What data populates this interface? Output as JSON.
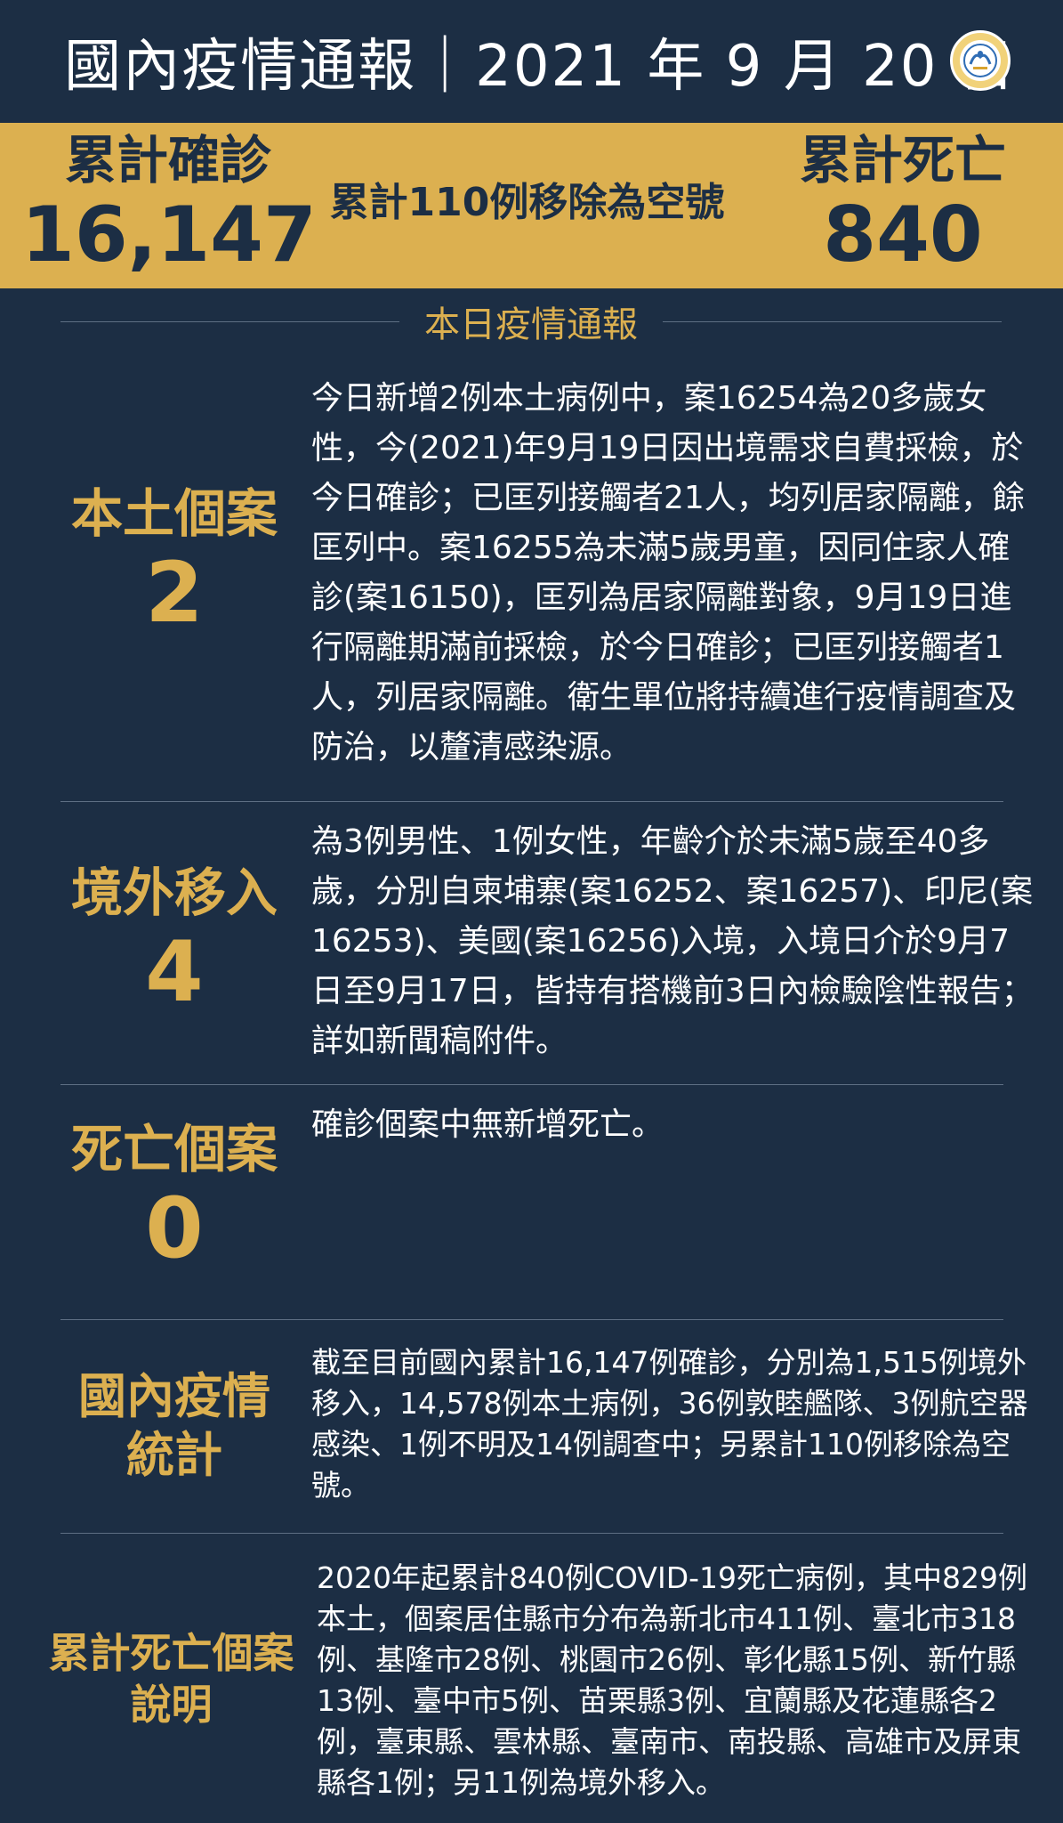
{
  "header": {
    "title": "國內疫情通報｜2021 年 9 月 20 日",
    "logo_icon": "cdc-logo-icon"
  },
  "summary": {
    "cumulative_cases_label": "累計確診",
    "cumulative_cases_value": "16,147",
    "note": "累計110例移除為空號",
    "cumulative_deaths_label": "累計死亡",
    "cumulative_deaths_value": "840"
  },
  "section_title": "本日疫情通報",
  "sections": [
    {
      "label": "本土個案",
      "value": "2",
      "description": "今日新增2例本土病例中，案16254為20多歲女性，今(2021)年9月19日因出境需求自費採檢，於今日確診；已匡列接觸者21人，均列居家隔離，餘匡列中。案16255為未滿5歲男童，因同住家人確診(案16150)，匡列為居家隔離對象，9月19日進行隔離期滿前採檢，於今日確診；已匡列接觸者1人，列居家隔離。衛生單位將持續進行疫情調查及防治，以釐清感染源。"
    },
    {
      "label": "境外移入",
      "value": "4",
      "description": "為3例男性、1例女性，年齡介於未滿5歲至40多歲，分別自柬埔寨(案16252、案16257)、印尼(案16253)、美國(案16256)入境，入境日介於9月7日至9月17日，皆持有搭機前3日內檢驗陰性報告；詳如新聞稿附件。"
    },
    {
      "label": "死亡個案",
      "value": "0",
      "description": "確診個案中無新增死亡。"
    },
    {
      "label_line1": "國內疫情",
      "label_line2": "統計",
      "description": "截至目前國內累計16,147例確診，分別為1,515例境外移入，14,578例本土病例，36例敦睦艦隊、3例航空器感染、1例不明及14例調查中；另累計110例移除為空號。"
    },
    {
      "label_line1": "累計死亡個案",
      "label_line2": "說明",
      "description": "2020年起累計840例COVID-19死亡病例，其中829例本土，個案居住縣市分布為新北市411例、臺北市318例、基隆市28例、桃園市26例、彰化縣15例、新竹縣13例、臺中市5例、苗栗縣3例、宜蘭縣及花蓮縣各2例，臺東縣、雲林縣、臺南市、南投縣、高雄市及屏東縣各1例；另11例為境外移入。"
    }
  ],
  "colors": {
    "background": "#1c2e44",
    "accent_gold": "#dcb050",
    "text": "#ffffff"
  }
}
